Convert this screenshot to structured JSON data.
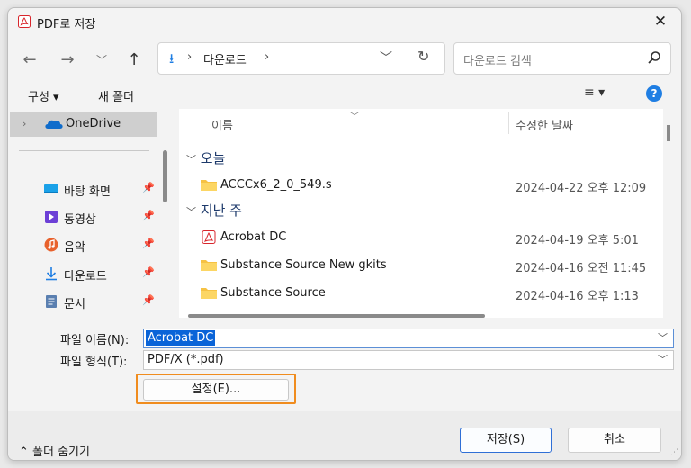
{
  "window": {
    "title": "PDF로 저장",
    "close_glyph": "✕"
  },
  "nav": {
    "back": "←",
    "forward": "→",
    "recent": "﹀",
    "up": "↑"
  },
  "address": {
    "path": "다운로드",
    "sep": "›",
    "chevron": "﹀",
    "refresh": "↻"
  },
  "search": {
    "placeholder": "다운로드 검색"
  },
  "toolbar": {
    "organize": "구성 ▾",
    "new_folder": "새 폴더",
    "view": "≡ ▾",
    "help": "?"
  },
  "sidebar": {
    "onedrive": {
      "chevron": "›",
      "label": "OneDrive"
    },
    "items": [
      {
        "label": "바탕 화면",
        "icon": "desktop-icon",
        "color": "#1aa1e8"
      },
      {
        "label": "동영상",
        "icon": "video-icon",
        "color": "#6c3fd6"
      },
      {
        "label": "음악",
        "icon": "music-icon",
        "color": "#e8612c"
      },
      {
        "label": "다운로드",
        "icon": "download-icon",
        "color": "#1f7ee3"
      },
      {
        "label": "문서",
        "icon": "document-icon",
        "color": "#5a7fb0"
      }
    ],
    "pin_glyph": "📌"
  },
  "filelist": {
    "col_name": "이름",
    "col_date": "수정한 날짜",
    "sort_glyph": "﹀",
    "groups": [
      {
        "label": "오늘",
        "files": [
          {
            "name": "ACCCx6_2_0_549.s",
            "date": "2024-04-22 오후 12:09",
            "icon": "folder-icon"
          }
        ]
      },
      {
        "label": "지난 주",
        "files": [
          {
            "name": "Acrobat DC",
            "date": "2024-04-19 오후 5:01",
            "icon": "pdf-file-icon"
          },
          {
            "name": "Substance Source New gkits",
            "date": "2024-04-16 오전 11:45",
            "icon": "folder-icon"
          },
          {
            "name": "Substance Source",
            "date": "2024-04-16 오후 1:13",
            "icon": "folder-icon"
          }
        ]
      }
    ]
  },
  "form": {
    "filename_label": "파일 이름(N):",
    "filename_value": "Acrobat DC",
    "filetype_label": "파일 형식(T):",
    "filetype_value": "PDF/X (*.pdf)",
    "settings_button": "설정(E)..."
  },
  "footer": {
    "hide_folders": "⌃ 폴더 숨기기",
    "save_button": "저장(S)",
    "cancel_button": "취소"
  },
  "colors": {
    "accent": "#1f7ee3",
    "highlight": "#f08c1e",
    "selection": "#0a64d8"
  }
}
